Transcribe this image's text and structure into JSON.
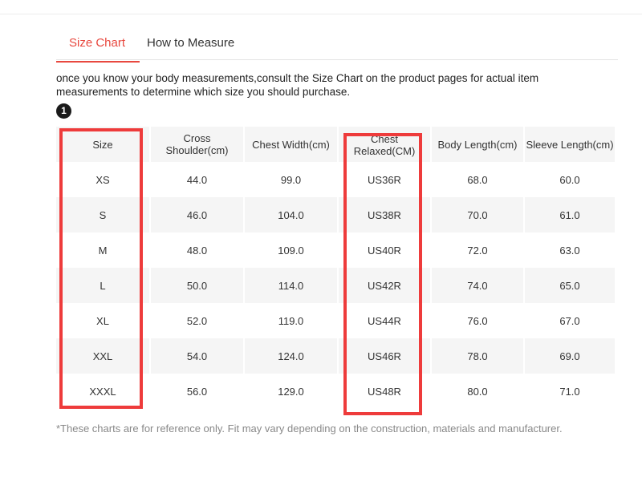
{
  "tabs": [
    {
      "label": "Size Chart",
      "active": true
    },
    {
      "label": "How to Measure",
      "active": false
    }
  ],
  "intro": "once you know your body measurements,consult the Size Chart on the product pages for actual item measurements to determine which size you should purchase.",
  "step_badge": "1",
  "table": {
    "headers": [
      "Size",
      "Cross Shoulder(cm)",
      "Chest Width(cm)",
      "Chest Relaxed(CM)",
      "Body Length(cm)",
      "Sleeve Length(cm)"
    ],
    "rows": [
      [
        "XS",
        "44.0",
        "99.0",
        "US36R",
        "68.0",
        "60.0"
      ],
      [
        "S",
        "46.0",
        "104.0",
        "US38R",
        "70.0",
        "61.0"
      ],
      [
        "M",
        "48.0",
        "109.0",
        "US40R",
        "72.0",
        "63.0"
      ],
      [
        "L",
        "50.0",
        "114.0",
        "US42R",
        "74.0",
        "65.0"
      ],
      [
        "XL",
        "52.0",
        "119.0",
        "US44R",
        "76.0",
        "67.0"
      ],
      [
        "XXL",
        "54.0",
        "124.0",
        "US46R",
        "78.0",
        "69.0"
      ],
      [
        "XXXL",
        "56.0",
        "129.0",
        "US48R",
        "80.0",
        "71.0"
      ]
    ]
  },
  "footnote": "*These charts are for reference only. Fit may vary depending on the construction, materials and manufacturer.",
  "colors": {
    "accent": "#e8483f",
    "highlight": "#ee3b3b",
    "stripe": "#f5f5f5"
  }
}
